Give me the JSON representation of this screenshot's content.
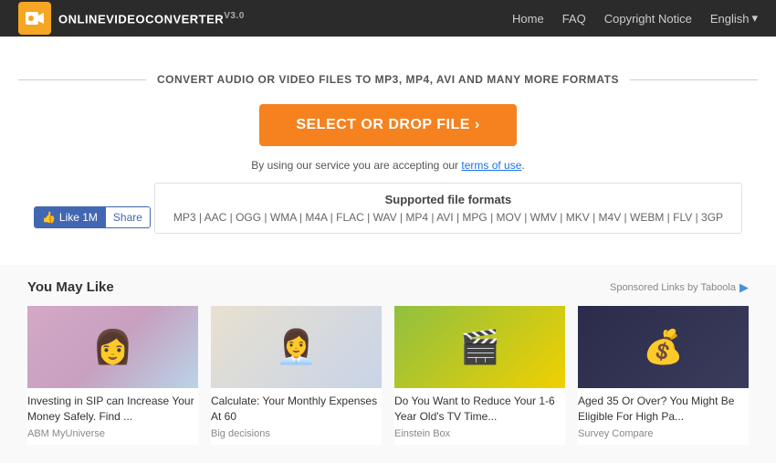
{
  "header": {
    "logo_text": "OnlineVideoConverter",
    "logo_version": "v3.0",
    "nav": {
      "home": "Home",
      "faq": "FAQ",
      "copyright": "Copyright Notice",
      "language": "English"
    }
  },
  "converter": {
    "tagline": "CONVERT AUDIO OR VIDEO FILES TO MP3, MP4, AVI AND MANY MORE FORMATS",
    "select_btn": "SELECT OR DROP FILE  ›",
    "terms_prefix": "By using our service you are accepting our ",
    "terms_link": "terms of use",
    "terms_suffix": ".",
    "fb_like": "Like 1M",
    "fb_share": "Share",
    "formats_title": "Supported file formats",
    "formats_list": "MP3 | AAC | OGG | WMA | M4A | FLAC | WAV | MP4 | AVI | MPG | MOV | WMV | MKV | M4V | WEBM | FLV | 3GP"
  },
  "recommendations": {
    "title": "You May Like",
    "sponsored": "Sponsored Links by Taboola",
    "cards": [
      {
        "title": "Investing in SIP can Increase Your Money Safely. Find ...",
        "source": "ABM MyUniverse",
        "img_emoji": "👩"
      },
      {
        "title": "Calculate: Your Monthly Expenses At 60",
        "source": "Big decisions",
        "img_emoji": "👩‍💼"
      },
      {
        "title": "Do You Want to Reduce Your 1-6 Year Old's TV Time...",
        "source": "Einstein Box",
        "img_emoji": "🎬"
      },
      {
        "title": "Aged 35 Or Over? You Might Be Eligible For High Pa...",
        "source": "Survey Compare",
        "img_emoji": "💰"
      }
    ]
  }
}
